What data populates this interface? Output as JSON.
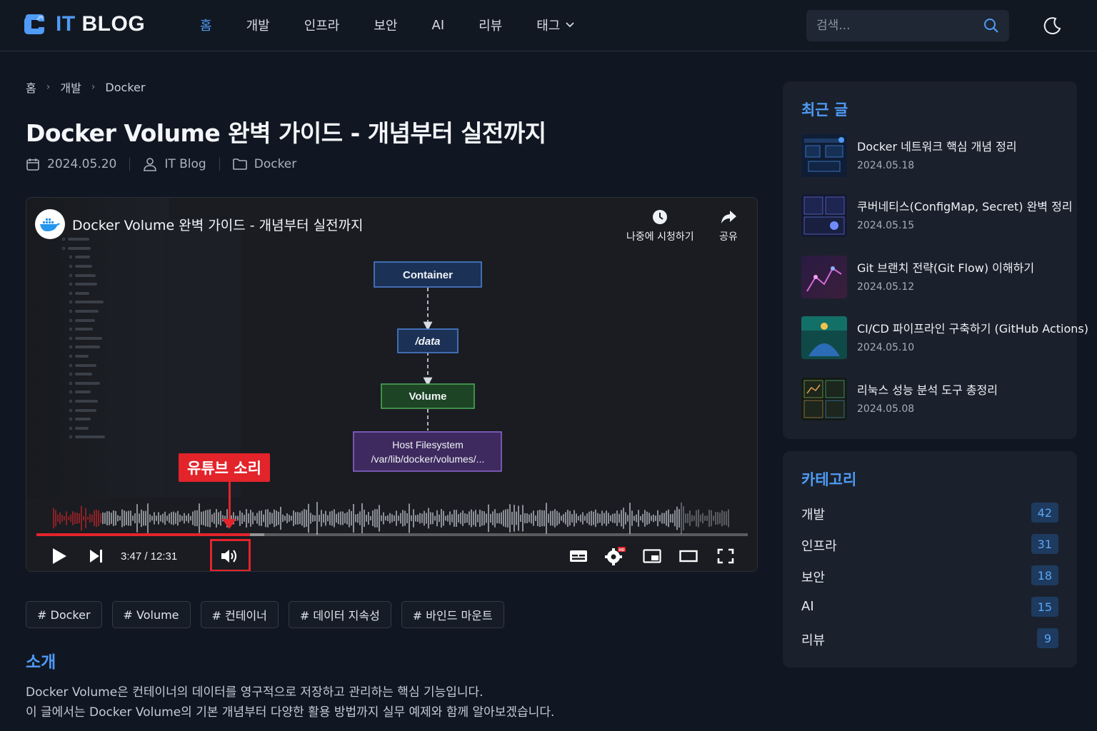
{
  "header": {
    "logo_it": "IT",
    "logo_blog": "BLOG",
    "nav": [
      {
        "label": "홈",
        "active": true
      },
      {
        "label": "개발"
      },
      {
        "label": "인프라"
      },
      {
        "label": "보안"
      },
      {
        "label": "AI"
      },
      {
        "label": "리뷰"
      },
      {
        "label": "태그"
      }
    ],
    "search_placeholder": "검색...",
    "accent": "#4f9bf5"
  },
  "breadcrumb": [
    "홈",
    "개발",
    "Docker"
  ],
  "post": {
    "title": "Docker Volume 완벽 가이드 - 개념부터 실전까지",
    "date": "2024.05.20",
    "author": "IT Blog",
    "category": "Docker"
  },
  "video": {
    "title": "Docker Volume 완벽 가이드 - 개념부터 실전까지",
    "watch_later": "나중에 시청하기",
    "share": "공유",
    "time": "3:47 / 12:31",
    "progress": 0.3,
    "buffered": 0.32,
    "annotation": "유튜브 소리",
    "diagram": {
      "container": "Container",
      "data": "/data",
      "volume": "Volume",
      "host_title": "Host Filesystem",
      "host_path": "/var/lib/docker/volumes/..."
    }
  },
  "tags": [
    "# Docker",
    "# Volume",
    "# 컨테이너",
    "# 데이터 지속성",
    "# 바인드 마운트"
  ],
  "intro": {
    "heading": "소개",
    "line1": "Docker Volume은 컨테이너의 데이터를 영구적으로 저장하고 관리하는 핵심 기능입니다.",
    "line2": "이 글에서는 Docker Volume의 기본 개념부터 다양한 활용 방법까지 실무 예제와 함께 알아보겠습니다."
  },
  "sidebar": {
    "recent_title": "최근 글",
    "recent": [
      {
        "title": "Docker 네트워크 핵심 개념 정리",
        "date": "2024.05.18"
      },
      {
        "title": "쿠버네티스(ConfigMap, Secret) 완벽 정리",
        "date": "2024.05.15"
      },
      {
        "title": "Git 브랜치 전략(Git Flow) 이해하기",
        "date": "2024.05.12"
      },
      {
        "title": "CI/CD 파이프라인 구축하기 (GitHub Actions)",
        "date": "2024.05.10"
      },
      {
        "title": "리눅스 성능 분석 도구 총정리",
        "date": "2024.05.08"
      }
    ],
    "category_title": "카테고리",
    "categories": [
      {
        "name": "개발",
        "count": "42"
      },
      {
        "name": "인프라",
        "count": "31"
      },
      {
        "name": "보안",
        "count": "18"
      },
      {
        "name": "AI",
        "count": "15"
      },
      {
        "name": "리뷰",
        "count": "9"
      }
    ]
  }
}
